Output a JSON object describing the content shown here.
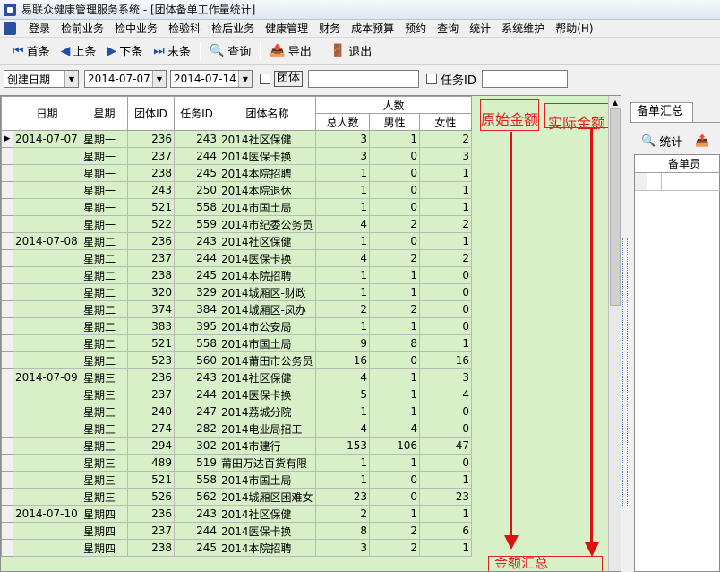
{
  "title": "易联众健康管理服务系统 - [团体备单工作量统计]",
  "menu": [
    "登录",
    "检前业务",
    "检中业务",
    "检验科",
    "检后业务",
    "健康管理",
    "财务",
    "成本预算",
    "预约",
    "查询",
    "统计",
    "系统维护",
    "帮助(H)"
  ],
  "toolbar": {
    "first": "首条",
    "prev": "上条",
    "next": "下条",
    "last": "末条",
    "query": "查询",
    "export": "导出",
    "exit": "退出"
  },
  "filter": {
    "date_field": "创建日期",
    "date_from": "2014-07-07",
    "date_to": "2014-07-14",
    "group_label": "团体",
    "group_value": "",
    "task_label": "任务ID",
    "task_value": ""
  },
  "grid": {
    "headers": {
      "date": "日期",
      "weekday": "星期",
      "group_id": "团体ID",
      "task_id": "任务ID",
      "group_name": "团体名称",
      "people": "人数",
      "total": "总人数",
      "male": "男性",
      "female": "女性"
    },
    "rows": [
      [
        "2014-07-07",
        "星期一",
        "236",
        "243",
        "2014社区保健",
        "3",
        "1",
        "2"
      ],
      [
        "",
        "星期一",
        "237",
        "244",
        "2014医保卡换",
        "3",
        "0",
        "3"
      ],
      [
        "",
        "星期一",
        "238",
        "245",
        "2014本院招聘",
        "1",
        "0",
        "1"
      ],
      [
        "",
        "星期一",
        "243",
        "250",
        "2014本院退休",
        "1",
        "0",
        "1"
      ],
      [
        "",
        "星期一",
        "521",
        "558",
        "2014市国土局",
        "1",
        "0",
        "1"
      ],
      [
        "",
        "星期一",
        "522",
        "559",
        "2014市纪委公务员",
        "4",
        "2",
        "2"
      ],
      [
        "2014-07-08",
        "星期二",
        "236",
        "243",
        "2014社区保健",
        "1",
        "0",
        "1"
      ],
      [
        "",
        "星期二",
        "237",
        "244",
        "2014医保卡换",
        "4",
        "2",
        "2"
      ],
      [
        "",
        "星期二",
        "238",
        "245",
        "2014本院招聘",
        "1",
        "1",
        "0"
      ],
      [
        "",
        "星期二",
        "320",
        "329",
        "2014城厢区-财政",
        "1",
        "1",
        "0"
      ],
      [
        "",
        "星期二",
        "374",
        "384",
        "2014城厢区-凤办",
        "2",
        "2",
        "0"
      ],
      [
        "",
        "星期二",
        "383",
        "395",
        "2014市公安局",
        "1",
        "1",
        "0"
      ],
      [
        "",
        "星期二",
        "521",
        "558",
        "2014市国土局",
        "9",
        "8",
        "1"
      ],
      [
        "",
        "星期二",
        "523",
        "560",
        "2014莆田市公务员",
        "16",
        "0",
        "16"
      ],
      [
        "2014-07-09",
        "星期三",
        "236",
        "243",
        "2014社区保健",
        "4",
        "1",
        "3"
      ],
      [
        "",
        "星期三",
        "237",
        "244",
        "2014医保卡换",
        "5",
        "1",
        "4"
      ],
      [
        "",
        "星期三",
        "240",
        "247",
        "2014荔城分院",
        "1",
        "1",
        "0"
      ],
      [
        "",
        "星期三",
        "274",
        "282",
        "2014电业局招工",
        "4",
        "4",
        "0"
      ],
      [
        "",
        "星期三",
        "294",
        "302",
        "2014市建行",
        "153",
        "106",
        "47"
      ],
      [
        "",
        "星期三",
        "489",
        "519",
        "莆田万达百货有限",
        "1",
        "1",
        "0"
      ],
      [
        "",
        "星期三",
        "521",
        "558",
        "2014市国土局",
        "1",
        "0",
        "1"
      ],
      [
        "",
        "星期三",
        "526",
        "562",
        "2014城厢区困难女",
        "23",
        "0",
        "23"
      ],
      [
        "2014-07-10",
        "星期四",
        "236",
        "243",
        "2014社区保健",
        "2",
        "1",
        "1"
      ],
      [
        "",
        "星期四",
        "237",
        "244",
        "2014医保卡换",
        "8",
        "2",
        "6"
      ],
      [
        "",
        "星期四",
        "238",
        "245",
        "2014本院招聘",
        "3",
        "2",
        "1"
      ]
    ]
  },
  "annotations": {
    "original": "原始金额",
    "actual": "实际金额",
    "total": "金额汇总"
  },
  "right_panel": {
    "tab": "备单汇总",
    "stats": "统计",
    "col": "备单员"
  },
  "colors": {
    "grid_bg": "#d7f0c7",
    "annotation": "#e02020"
  }
}
